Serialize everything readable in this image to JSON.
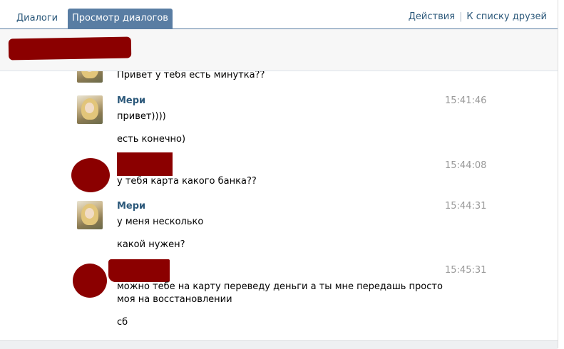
{
  "tabs": {
    "dialogs": "Диалоги",
    "view_dialogs": "Просмотр диалогов"
  },
  "links": {
    "actions": "Действия",
    "separator": "|",
    "friends_list": "К списку друзей"
  },
  "messages": [
    {
      "text": "Привет у тебя есть минутка??"
    },
    {
      "sender": "Мери",
      "time": "15:41:46",
      "lines": [
        "привет))))",
        "есть конечно)"
      ]
    },
    {
      "time": "15:44:08",
      "lines": [
        "у тебя карта какого банка??"
      ]
    },
    {
      "sender": "Мери",
      "time": "15:44:31",
      "lines": [
        "у меня несколько",
        "какой нужен?"
      ]
    },
    {
      "time": "15:45:31",
      "lines": [
        "можно тебе на карту переведу деньги а ты мне передашь просто",
        "моя на восстановлении",
        "сб"
      ]
    }
  ],
  "colors": {
    "accent": "#597da3",
    "link": "#2b587a",
    "redaction": "#8b0000",
    "timestamp": "#999999"
  }
}
